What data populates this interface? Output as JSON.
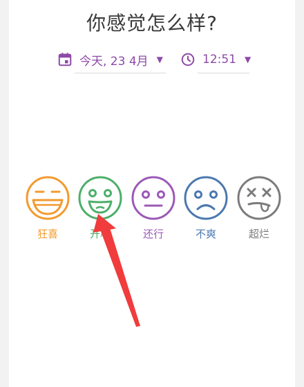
{
  "header": {
    "title": "你感觉怎么样?"
  },
  "date_picker": {
    "value": "今天, 23 4月",
    "icon": "calendar-icon"
  },
  "time_picker": {
    "value": "12:51",
    "icon": "clock-icon"
  },
  "moods": [
    {
      "label": "狂喜",
      "color": "#f29a2e",
      "icon": "ecstatic-face-icon"
    },
    {
      "label": "开心",
      "color": "#4caf6a",
      "icon": "happy-face-icon"
    },
    {
      "label": "还行",
      "color": "#9b59b6",
      "icon": "neutral-face-icon"
    },
    {
      "label": "不爽",
      "color": "#4a78b0",
      "icon": "sad-face-icon"
    },
    {
      "label": "超烂",
      "color": "#7b7b7b",
      "icon": "awful-face-icon"
    }
  ],
  "colors": {
    "accent": "#8e4aa8",
    "annotation_arrow": "#f03c3c"
  }
}
